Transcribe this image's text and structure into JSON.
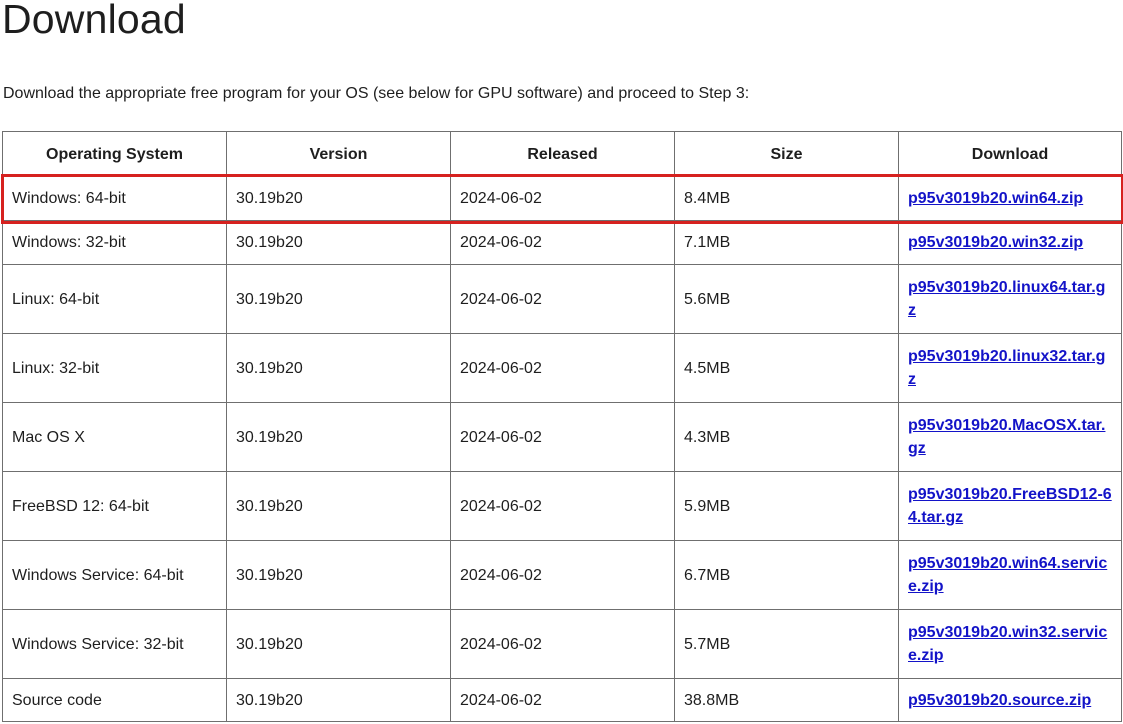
{
  "page": {
    "title": "Download",
    "intro": "Download the appropriate free program for your OS (see below for GPU software) and proceed to Step 3:"
  },
  "table": {
    "headers": [
      "Operating System",
      "Version",
      "Released",
      "Size",
      "Download"
    ],
    "rows": [
      {
        "os": "Windows: 64-bit",
        "version": "30.19b20",
        "released": "2024-06-02",
        "size": "8.4MB",
        "file": "p95v3019b20.win64.zip"
      },
      {
        "os": "Windows: 32-bit",
        "version": "30.19b20",
        "released": "2024-06-02",
        "size": "7.1MB",
        "file": "p95v3019b20.win32.zip"
      },
      {
        "os": "Linux: 64-bit",
        "version": "30.19b20",
        "released": "2024-06-02",
        "size": "5.6MB",
        "file": "p95v3019b20.linux64.tar.gz"
      },
      {
        "os": "Linux: 32-bit",
        "version": "30.19b20",
        "released": "2024-06-02",
        "size": "4.5MB",
        "file": "p95v3019b20.linux32.tar.gz"
      },
      {
        "os": "Mac OS X",
        "version": "30.19b20",
        "released": "2024-06-02",
        "size": "4.3MB",
        "file": "p95v3019b20.MacOSX.tar.gz"
      },
      {
        "os": "FreeBSD 12: 64-bit",
        "version": "30.19b20",
        "released": "2024-06-02",
        "size": "5.9MB",
        "file": "p95v3019b20.FreeBSD12-64.tar.gz"
      },
      {
        "os": "Windows Service: 64-bit",
        "version": "30.19b20",
        "released": "2024-06-02",
        "size": "6.7MB",
        "file": "p95v3019b20.win64.service.zip"
      },
      {
        "os": "Windows Service: 32-bit",
        "version": "30.19b20",
        "released": "2024-06-02",
        "size": "5.7MB",
        "file": "p95v3019b20.win32.service.zip"
      },
      {
        "os": "Source code",
        "version": "30.19b20",
        "released": "2024-06-02",
        "size": "38.8MB",
        "file": "p95v3019b20.source.zip"
      }
    ]
  },
  "colors": {
    "link": "#1313c8",
    "highlight": "#d6211f",
    "border": "#6f6f6f",
    "text": "#1e1e1e"
  }
}
